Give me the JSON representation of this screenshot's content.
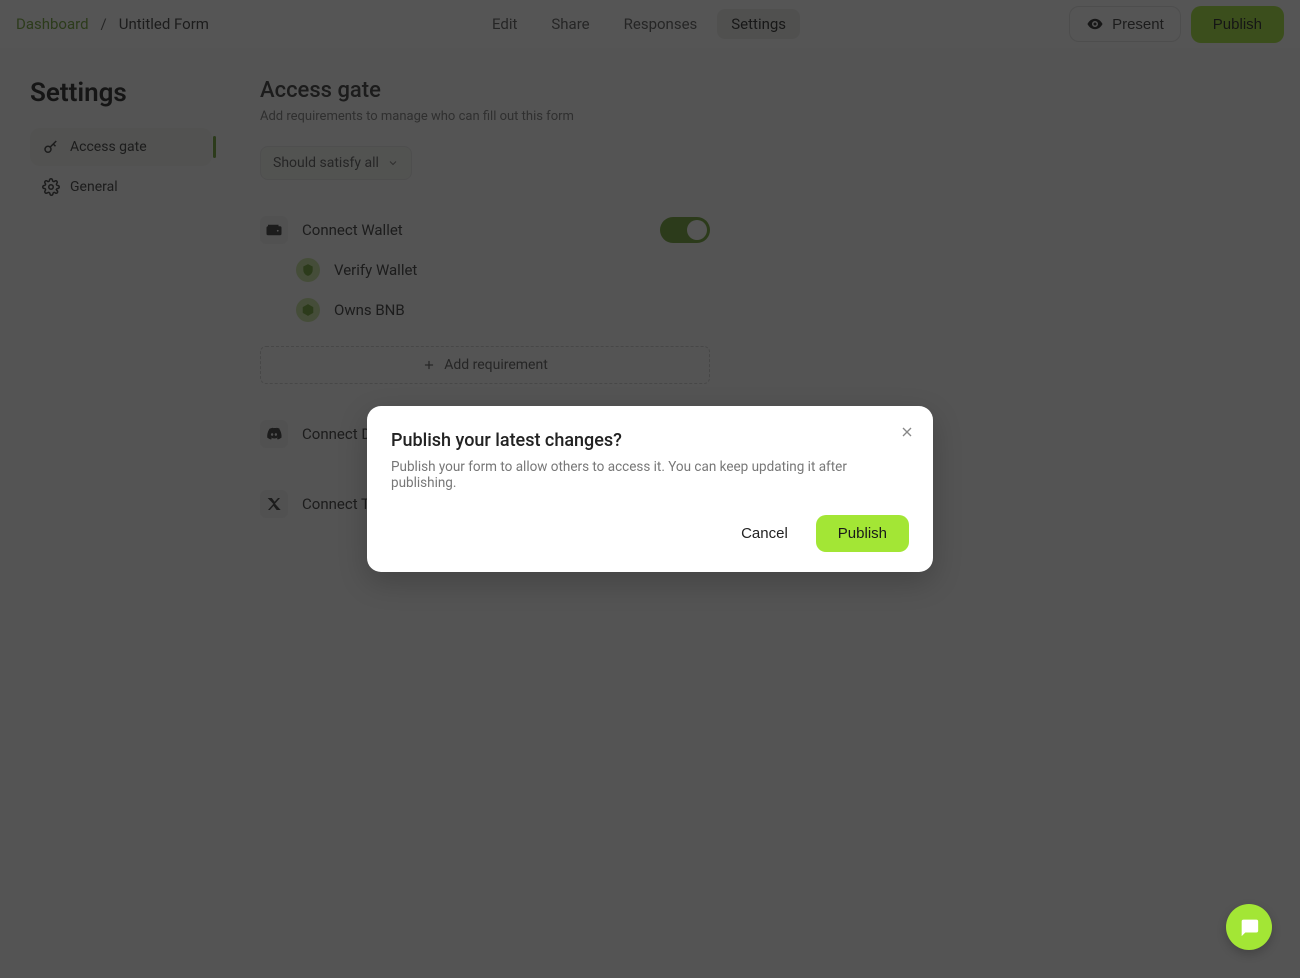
{
  "breadcrumb": {
    "home": "Dashboard",
    "sep": "/",
    "current": "Untitled Form"
  },
  "nav": {
    "edit": "Edit",
    "share": "Share",
    "responses": "Responses",
    "settings": "Settings"
  },
  "header": {
    "present": "Present",
    "publish": "Publish"
  },
  "sidebar": {
    "title": "Settings",
    "items": [
      {
        "label": "Access gate"
      },
      {
        "label": "General"
      }
    ]
  },
  "page": {
    "title": "Access gate",
    "subtitle": "Add requirements to manage who can fill out this form",
    "satisfy": "Should satisfy all"
  },
  "gate": {
    "wallet": "Connect Wallet",
    "verify": "Verify Wallet",
    "owns": "Owns BNB",
    "add": "Add requirement",
    "discord": "Connect Discord",
    "twitter": "Connect Twitter"
  },
  "modal": {
    "title": "Publish your latest changes?",
    "subtitle": "Publish your form to allow others to access it. You can keep updating it after publishing.",
    "cancel": "Cancel",
    "publish": "Publish"
  }
}
